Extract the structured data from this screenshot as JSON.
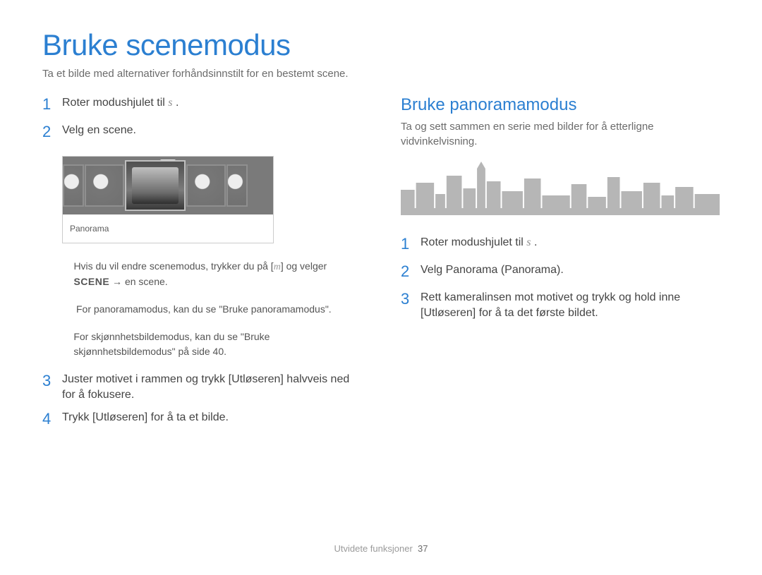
{
  "title": "Bruke scenemodus",
  "subtitle": "Ta et bilde med alternativer forhåndsinnstilt for en bestemt scene.",
  "left": {
    "step1": "Roter modushjulet til ",
    "step1_icon": "s",
    "step1_tail": " .",
    "step2": "Velg en scene.",
    "scene_label": "Panorama",
    "note_a_pre": "Hvis du vil endre scenemodus, trykker du på [",
    "note_a_icon": "m",
    "note_a_mid": "] og velger ",
    "note_a_scene": "SCENE",
    "note_a_arrow": " → ",
    "note_a_post": "en scene.",
    "note_b": "For panoramamodus, kan du se \"Bruke panoramamodus\".",
    "note_c": "For skjønnhetsbildemodus, kan du se \"Bruke skjønnhetsbildemodus\" på side 40.",
    "step3": "Juster motivet i rammen og trykk [Utløseren] halvveis ned for å fokusere.",
    "step4": "Trykk [Utløseren] for å ta et bilde."
  },
  "right": {
    "heading": "Bruke panoramamodus",
    "sub": "Ta og sett sammen en serie med bilder for å etterligne vidvinkelvisning.",
    "step1": "Roter modushjulet til ",
    "step1_icon": "s",
    "step1_tail": " .",
    "step2": "Velg Panorama (Panorama).",
    "step3": "Rett kameralinsen mot motivet og trykk og hold inne [Utløseren] for å ta det første bildet."
  },
  "footer": {
    "section": "Utvidete funksjoner",
    "page": "37"
  }
}
